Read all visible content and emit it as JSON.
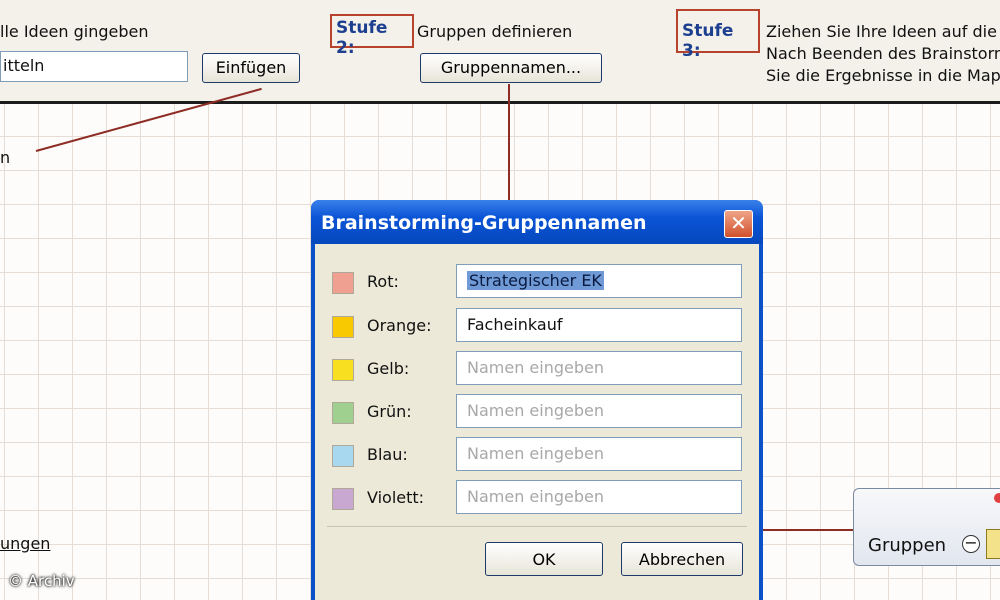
{
  "toolbar": {
    "step1_text": "lle Ideen gingeben",
    "input_value": "itteln",
    "insert_button": "Einfügen",
    "step2_label": "Stufe 2:",
    "step2_text": "Gruppen definieren",
    "group_names_button": "Gruppennamen...",
    "step3_label": "Stufe 3:",
    "step3_line1": "Ziehen Sie Ihre Ideen auf die",
    "step3_line2": "Nach Beenden des Brainstorm",
    "step3_line3": "Sie die Ergebnisse in die Map."
  },
  "canvas": {
    "left_fragment": "n",
    "bottom_fragment": "ungen"
  },
  "dialog": {
    "title": "Brainstorming-Gruppennamen",
    "close_glyph": "✕",
    "rows": [
      {
        "label": "Rot:",
        "color": "#f0a090",
        "value": "Strategischer EK",
        "placeholder": ""
      },
      {
        "label": "Orange:",
        "color": "#f8c800",
        "value": "Facheinkauf",
        "placeholder": ""
      },
      {
        "label": "Gelb:",
        "color": "#f8e020",
        "value": "",
        "placeholder": "Namen eingeben"
      },
      {
        "label": "Grün:",
        "color": "#9fd090",
        "value": "",
        "placeholder": "Namen eingeben"
      },
      {
        "label": "Blau:",
        "color": "#a8d8f0",
        "value": "",
        "placeholder": "Namen eingeben"
      },
      {
        "label": "Violett:",
        "color": "#c8a8d0",
        "value": "",
        "placeholder": "Namen eingeben"
      }
    ],
    "ok_button": "OK",
    "cancel_button": "Abbrechen"
  },
  "map_node": {
    "label": "Gruppen",
    "collapse_glyph": "−"
  },
  "watermark": "© Archiv"
}
